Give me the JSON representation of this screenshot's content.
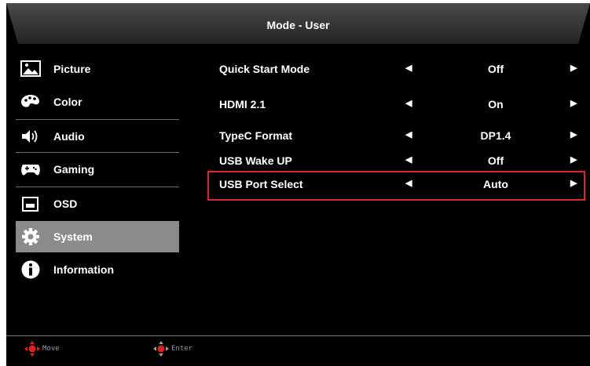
{
  "header": {
    "title": "Mode - User"
  },
  "sidebar": {
    "items": [
      {
        "label": "Picture",
        "icon": "picture-icon"
      },
      {
        "label": "Color",
        "icon": "palette-icon"
      },
      {
        "label": "Audio",
        "icon": "speaker-icon"
      },
      {
        "label": "Gaming",
        "icon": "gamepad-icon"
      },
      {
        "label": "OSD",
        "icon": "osd-window-icon"
      },
      {
        "label": "System",
        "icon": "gear-icon",
        "active": true
      },
      {
        "label": "Information",
        "icon": "info-icon"
      }
    ]
  },
  "settings": {
    "rows": [
      {
        "name": "Quick Start Mode",
        "value": "Off"
      },
      {
        "name": "HDMI 2.1",
        "value": "On"
      },
      {
        "name": "TypeC Format",
        "value": "DP1.4"
      },
      {
        "name": "USB Wake UP",
        "value": "Off"
      },
      {
        "name": "USB Port Select",
        "value": "Auto",
        "selected": true
      }
    ],
    "left_arrow": "◀",
    "right_arrow": "▶"
  },
  "footer": {
    "move_label": "Move",
    "enter_label": "Enter"
  },
  "colors": {
    "background": "#000000",
    "header_bar": "#3a3a3a",
    "active_item": "#8b8b8b",
    "selection_border": "#d9272e",
    "dpad_accent": "#e0201f"
  }
}
